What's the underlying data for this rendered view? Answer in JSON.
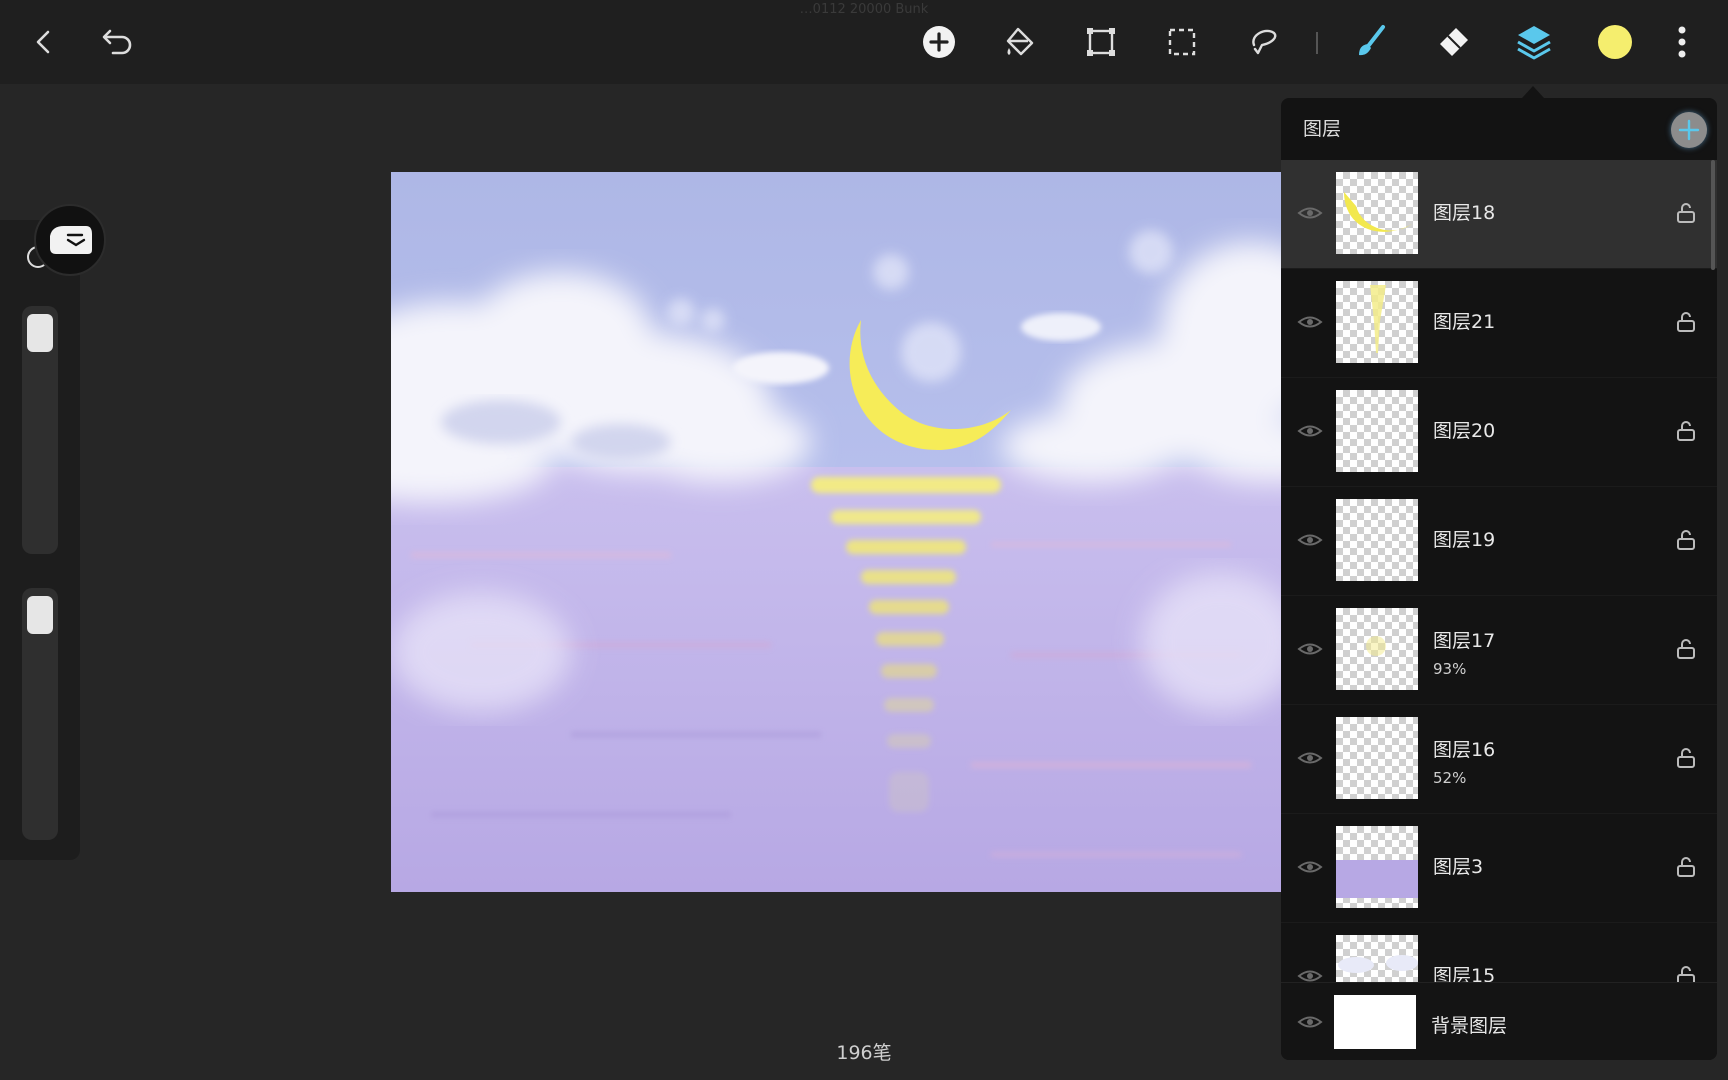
{
  "document": {
    "title": "…0112 20000 Bunk"
  },
  "toolbar": {
    "accent_color": "#5ac8ec",
    "current_color": "#f5ee6e",
    "buttons": [
      {
        "name": "back-icon"
      },
      {
        "name": "undo-icon"
      },
      {
        "name": "add-icon"
      },
      {
        "name": "fill-icon"
      },
      {
        "name": "transform-icon"
      },
      {
        "name": "selection-icon"
      },
      {
        "name": "lasso-icon"
      },
      {
        "name": "brush-icon"
      },
      {
        "name": "eraser-icon"
      },
      {
        "name": "layers-icon"
      },
      {
        "name": "more-icon"
      }
    ]
  },
  "layers_panel": {
    "title": "图层",
    "layers": [
      {
        "name": "图层18",
        "opacity": "",
        "selected": true,
        "thumb": "moon"
      },
      {
        "name": "图层21",
        "opacity": "",
        "selected": false,
        "thumb": "beam"
      },
      {
        "name": "图层20",
        "opacity": "",
        "selected": false,
        "thumb": "faint"
      },
      {
        "name": "图层19",
        "opacity": "",
        "selected": false,
        "thumb": "faint"
      },
      {
        "name": "图层17",
        "opacity": "93%",
        "selected": false,
        "thumb": "glow"
      },
      {
        "name": "图层16",
        "opacity": "52%",
        "selected": false,
        "thumb": "faint"
      },
      {
        "name": "图层3",
        "opacity": "",
        "selected": false,
        "thumb": "sea"
      },
      {
        "name": "图层15",
        "opacity": "",
        "selected": false,
        "thumb": "clouds"
      }
    ],
    "background_layer": "背景图层"
  },
  "status": {
    "stroke_count": "196笔"
  }
}
